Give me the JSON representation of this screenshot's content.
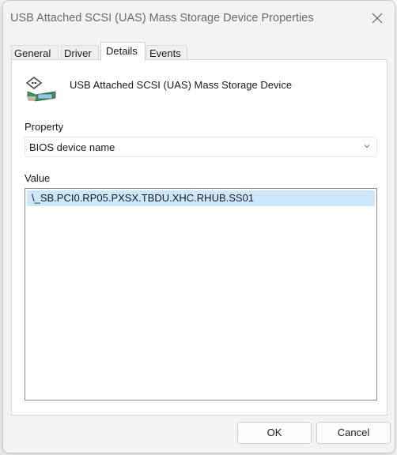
{
  "window": {
    "title": "USB Attached SCSI (UAS) Mass Storage Device Properties"
  },
  "tabs": [
    {
      "label": "General"
    },
    {
      "label": "Driver"
    },
    {
      "label": "Details",
      "active": true
    },
    {
      "label": "Events"
    }
  ],
  "device": {
    "name": "USB Attached SCSI (UAS) Mass Storage Device",
    "icon": "usb-storage-device-icon"
  },
  "property": {
    "label": "Property",
    "selected": "BIOS device name"
  },
  "value": {
    "label": "Value",
    "items": [
      "\\_SB.PCI0.RP05.PXSX.TBDU.XHC.RHUB.SS01"
    ]
  },
  "buttons": {
    "ok": "OK",
    "cancel": "Cancel"
  },
  "colors": {
    "selection": "#cce8ff",
    "accent": "#0078d4"
  }
}
